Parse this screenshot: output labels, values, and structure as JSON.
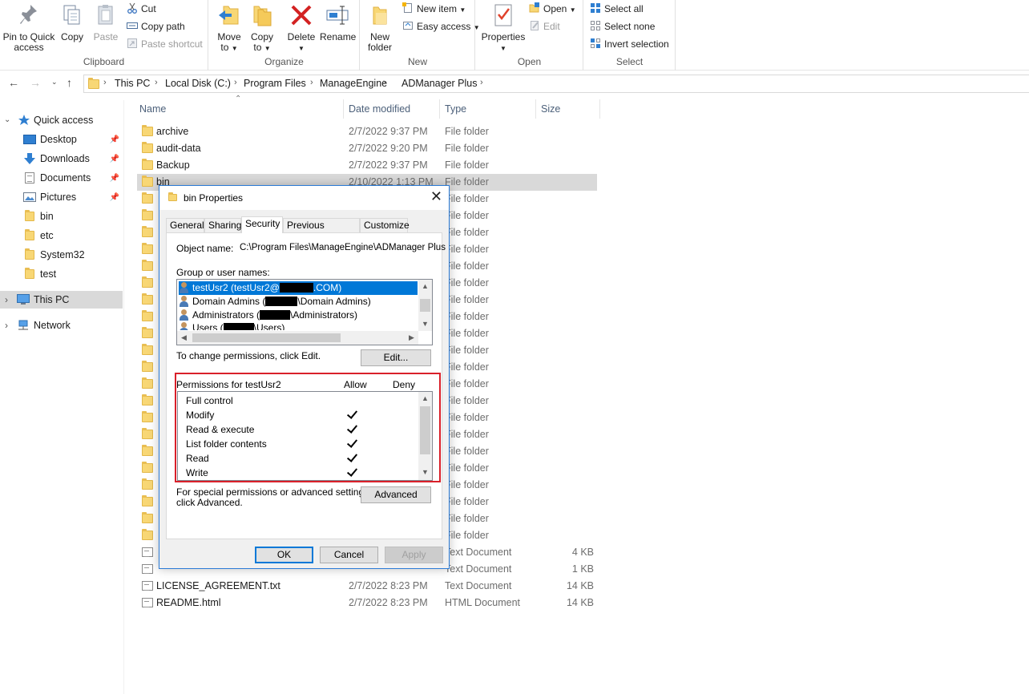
{
  "ribbon": {
    "clipboard": {
      "label": "Clipboard",
      "pin_label_1": "Pin to Quick",
      "pin_label_2": "access",
      "copy": "Copy",
      "paste": "Paste",
      "cut": "Cut",
      "copy_path": "Copy path",
      "paste_shortcut": "Paste shortcut"
    },
    "organize": {
      "label": "Organize",
      "move_to_1": "Move",
      "move_to_2": "to",
      "copy_to_1": "Copy",
      "copy_to_2": "to",
      "delete": "Delete",
      "rename": "Rename"
    },
    "new": {
      "label": "New",
      "new_folder_1": "New",
      "new_folder_2": "folder",
      "new_item": "New item",
      "easy_access": "Easy access"
    },
    "open": {
      "label": "Open",
      "properties": "Properties",
      "open": "Open",
      "edit": "Edit"
    },
    "select": {
      "label": "Select",
      "select_all": "Select all",
      "select_none": "Select none",
      "invert_selection": "Invert selection"
    }
  },
  "address": {
    "crumbs": [
      "This PC",
      "Local Disk (C:)",
      "Program Files",
      "ManageEngine",
      "ADManager Plus"
    ]
  },
  "navpane": {
    "quick_access": "Quick access",
    "items": [
      "Desktop",
      "Downloads",
      "Documents",
      "Pictures",
      "bin",
      "etc",
      "System32",
      "test"
    ],
    "this_pc": "This PC",
    "network": "Network"
  },
  "columns": {
    "name": "Name",
    "date": "Date modified",
    "type": "Type",
    "size": "Size"
  },
  "files": [
    {
      "name": "archive",
      "date": "2/7/2022 9:37 PM",
      "type": "File folder",
      "size": ""
    },
    {
      "name": "audit-data",
      "date": "2/7/2022 9:20 PM",
      "type": "File folder",
      "size": ""
    },
    {
      "name": "Backup",
      "date": "2/7/2022 9:37 PM",
      "type": "File folder",
      "size": ""
    },
    {
      "name": "bin",
      "date": "2/10/2022 1:13 PM",
      "type": "File folder",
      "size": ""
    },
    {
      "name": "",
      "date": "",
      "type": "File folder",
      "size": ""
    },
    {
      "name": "",
      "date": "",
      "type": "File folder",
      "size": ""
    },
    {
      "name": "",
      "date": "",
      "type": "File folder",
      "size": ""
    },
    {
      "name": "",
      "date": "",
      "type": "File folder",
      "size": ""
    },
    {
      "name": "",
      "date": "",
      "type": "File folder",
      "size": ""
    },
    {
      "name": "",
      "date": "",
      "type": "File folder",
      "size": ""
    },
    {
      "name": "",
      "date": "",
      "type": "File folder",
      "size": ""
    },
    {
      "name": "",
      "date": "",
      "type": "File folder",
      "size": ""
    },
    {
      "name": "",
      "date": "",
      "type": "File folder",
      "size": ""
    },
    {
      "name": "",
      "date": "",
      "type": "File folder",
      "size": ""
    },
    {
      "name": "",
      "date": "",
      "type": "File folder",
      "size": ""
    },
    {
      "name": "",
      "date": "",
      "type": "File folder",
      "size": ""
    },
    {
      "name": "",
      "date": "",
      "type": "File folder",
      "size": ""
    },
    {
      "name": "",
      "date": "",
      "type": "File folder",
      "size": ""
    },
    {
      "name": "",
      "date": "",
      "type": "File folder",
      "size": ""
    },
    {
      "name": "",
      "date": "",
      "type": "File folder",
      "size": ""
    },
    {
      "name": "",
      "date": "",
      "type": "File folder",
      "size": ""
    },
    {
      "name": "",
      "date": "",
      "type": "File folder",
      "size": ""
    },
    {
      "name": "",
      "date": "",
      "type": "File folder",
      "size": ""
    },
    {
      "name": "",
      "date": "",
      "type": "File folder",
      "size": ""
    },
    {
      "name": "",
      "date": "",
      "type": "File folder",
      "size": ""
    },
    {
      "name": "",
      "date": "",
      "type": "Text Document",
      "size": "4 KB"
    },
    {
      "name": "",
      "date": "",
      "type": "Text Document",
      "size": "1 KB"
    },
    {
      "name": "LICENSE_AGREEMENT.txt",
      "date": "2/7/2022 8:23 PM",
      "type": "Text Document",
      "size": "14 KB"
    },
    {
      "name": "README.html",
      "date": "2/7/2022 8:23 PM",
      "type": "HTML Document",
      "size": "14 KB"
    }
  ],
  "dialog": {
    "title": "bin Properties",
    "tabs": [
      "General",
      "Sharing",
      "Security",
      "Previous Versions",
      "Customize"
    ],
    "object_name_label": "Object name:",
    "object_name_value": "C:\\Program Files\\ManageEngine\\ADManager Plus",
    "group_label": "Group or user names:",
    "users": [
      {
        "prefix": "testUsr2 (testUsr2@",
        "suffix": ".COM)"
      },
      {
        "prefix": "Domain Admins (",
        "suffix": "\\Domain Admins)"
      },
      {
        "prefix": "Administrators (",
        "suffix": "\\Administrators)"
      },
      {
        "prefix": "Users (",
        "suffix": "\\Users)"
      }
    ],
    "change_text": "To change permissions, click Edit.",
    "edit_button": "Edit...",
    "perm_label": "Permissions for testUsr2",
    "allow": "Allow",
    "deny": "Deny",
    "permissions": [
      {
        "name": "Full control",
        "allow": false
      },
      {
        "name": "Modify",
        "allow": true
      },
      {
        "name": "Read & execute",
        "allow": true
      },
      {
        "name": "List folder contents",
        "allow": true
      },
      {
        "name": "Read",
        "allow": true
      },
      {
        "name": "Write",
        "allow": true
      }
    ],
    "special_text_1": "For special permissions or advanced settings,",
    "special_text_2": "click Advanced.",
    "advanced_button": "Advanced",
    "ok": "OK",
    "cancel": "Cancel",
    "apply": "Apply"
  }
}
